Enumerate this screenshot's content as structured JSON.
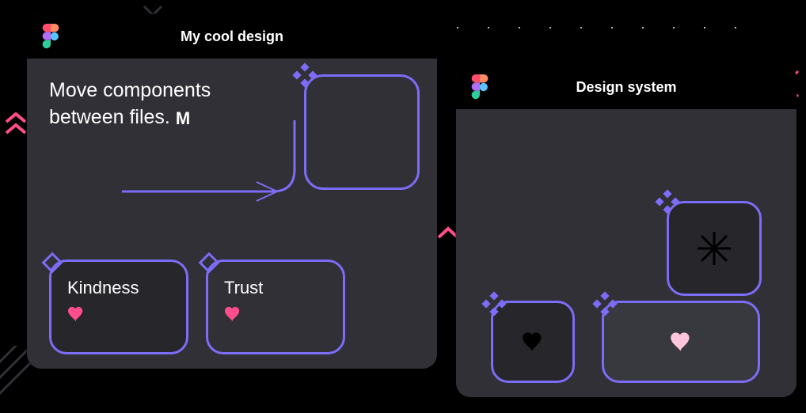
{
  "colors": {
    "purple": "#7c6cf6",
    "pink": "#ff4d8d",
    "panel": "#303036",
    "panel_dark": "#26262b"
  },
  "left_window": {
    "title": "My cool design",
    "tagline_line1": "Move components",
    "tagline_line2": "between files.",
    "tagline_glyph": "M",
    "cards": [
      {
        "label": "Kindness"
      },
      {
        "label": "Trust"
      }
    ]
  },
  "right_window": {
    "title": "Design system"
  }
}
